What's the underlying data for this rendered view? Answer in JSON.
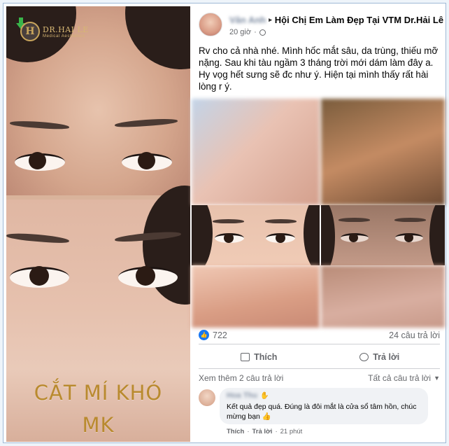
{
  "promo": {
    "logo_name": "DR.HAI LE",
    "logo_sub": "Medical Aesthetics",
    "logo_mark": "H",
    "title_line1": "CẮT MÍ KHÓ",
    "title_line2": "MK"
  },
  "post": {
    "author_name": "Vân Anh",
    "group_name": "Hội Chị Em Làm Đẹp Tại VTM Dr.Hải Lê",
    "time": "20 giờ",
    "text": "Rv cho cả nhà nhé. Mình hốc mắt sâu, da trùng, thiếu mỡ nặng. Sau khi tàu ngầm 3 tháng trời mới dám làm đây a. Hy vọg hết sưng sẽ đc như ý. Hiện tại mình thấy rất hài lòng r ý.",
    "like_count": "722",
    "comment_count": "24 câu trả lời",
    "like_label": "Thích",
    "reply_label": "Trả lời",
    "view_more_replies": "Xem thêm 2 câu trả lời",
    "all_replies": "Tất cả câu trả lời"
  },
  "comment": {
    "name": "Hoa Thu",
    "text": "Kết quả đẹp quá. Đúng là đôi mắt là cửa sổ tâm hồn, chúc mừng bạn 👍",
    "like_label": "Thích",
    "reply_label": "Trả lời",
    "time": "21 phút"
  },
  "icons": {
    "like": "like-icon",
    "globe": "globe-icon",
    "comment": "comment-icon",
    "caret": "caret-down-icon",
    "arrow": "download-arrow-icon"
  },
  "colors": {
    "facebook_blue": "#1877f2",
    "gold": "#b98a2e",
    "frame_border": "#9fb9d6"
  }
}
